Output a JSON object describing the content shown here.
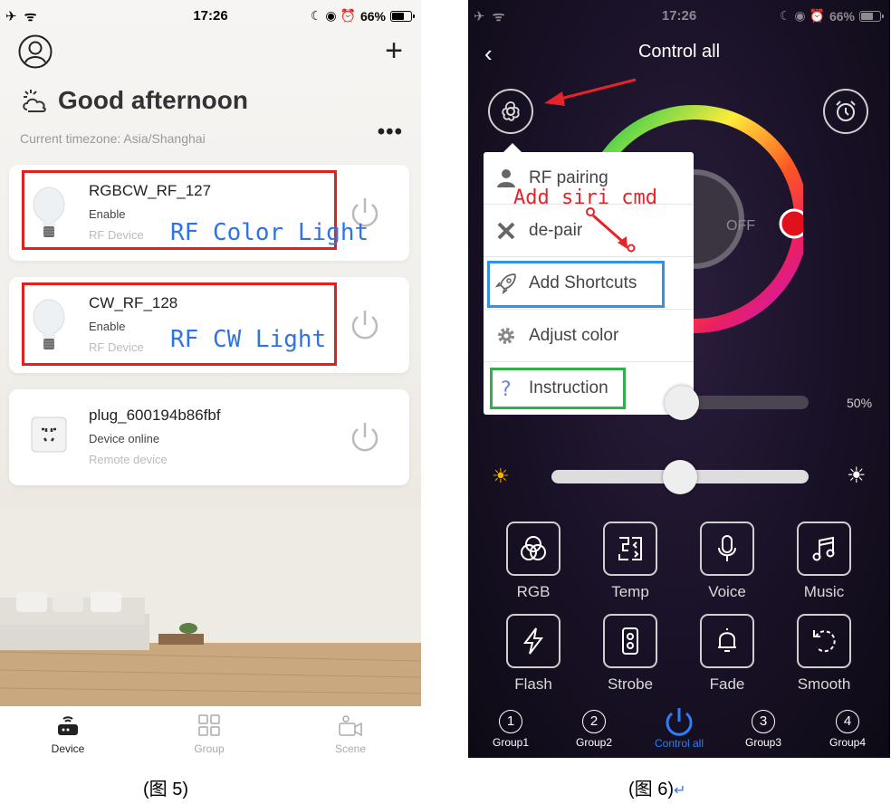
{
  "left_phone": {
    "status": {
      "time": "17:26",
      "battery": "66%"
    },
    "greeting": "Good afternoon",
    "timezone": "Current timezone: Asia/Shanghai",
    "devices": [
      {
        "name": "RGBCW_RF_127",
        "status": "Enable",
        "type": "RF Device",
        "annotation": "RF Color Light"
      },
      {
        "name": "CW_RF_128",
        "status": "Enable",
        "type": "RF Device",
        "annotation": "RF CW Light"
      },
      {
        "name": "plug_600194b86fbf",
        "status": "Device online",
        "type": "Remote device"
      }
    ],
    "tabs": [
      {
        "label": "Device",
        "active": true
      },
      {
        "label": "Group",
        "active": false
      },
      {
        "label": "Scene",
        "active": false
      }
    ],
    "caption": "(图 5)"
  },
  "right_phone": {
    "status": {
      "time": "17:26",
      "battery": "66%"
    },
    "title": "Control all",
    "menu": [
      {
        "label": "RF pairing",
        "icon": "person-icon"
      },
      {
        "label": "de-pair",
        "icon": "x-icon"
      },
      {
        "label": "Add Shortcuts",
        "icon": "rocket-icon"
      },
      {
        "label": "Adjust color",
        "icon": "gear-icon"
      },
      {
        "label": "Instruction",
        "icon": "question-icon"
      }
    ],
    "annotation_siri": "Add siri cmd",
    "off_label": "OFF",
    "brightness_percent": "50%",
    "brightness_value": 0.5,
    "functions": [
      {
        "label": "RGB",
        "icon": "rgb-icon"
      },
      {
        "label": "Temp",
        "icon": "temp-icon"
      },
      {
        "label": "Voice",
        "icon": "mic-icon"
      },
      {
        "label": "Music",
        "icon": "music-icon"
      },
      {
        "label": "Flash",
        "icon": "lightning-icon"
      },
      {
        "label": "Strobe",
        "icon": "strobe-icon"
      },
      {
        "label": "Fade",
        "icon": "bell-icon"
      },
      {
        "label": "Smooth",
        "icon": "smooth-icon"
      }
    ],
    "groups": [
      {
        "label": "Group1",
        "num": "1"
      },
      {
        "label": "Group2",
        "num": "2"
      },
      {
        "label": "Control all",
        "active": true
      },
      {
        "label": "Group3",
        "num": "3"
      },
      {
        "label": "Group4",
        "num": "4"
      }
    ],
    "caption": "(图 6)",
    "return_mark": "↵"
  }
}
